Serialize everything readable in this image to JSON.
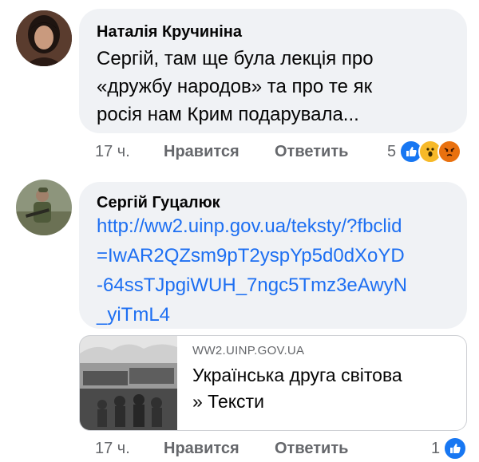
{
  "comments": [
    {
      "author": "Наталія Кручиніна",
      "text_lines": [
        "Сергій, там ще була лекція про",
        "«дружбу народов» та про те як",
        "росія нам Крим подарувала..."
      ],
      "time": "17 ч.",
      "like_label": "Нравится",
      "reply_label": "Ответить",
      "reaction_count": "5",
      "reaction_icons": [
        "like-icon",
        "wow-icon",
        "angry-icon"
      ]
    },
    {
      "author": "Сергій Гуцалюк",
      "link_lines": [
        "http://ww2.uinp.gov.ua/teksty/?fbclid",
        "=IwAR2QZsm9pT2yspYp5d0dXoYD",
        "-64ssTJpgiWUH_7ngc5Tmz3eAwyN",
        "_yiTmL4"
      ],
      "preview": {
        "domain": "WW2.UINP.GOV.UA",
        "title_lines": [
          "Українська друга світова",
          "» Тексти"
        ]
      },
      "time": "17 ч.",
      "like_label": "Нравится",
      "reply_label": "Ответить",
      "reaction_count": "1",
      "reaction_icons": [
        "like-icon"
      ]
    }
  ],
  "colors": {
    "bubble": "#f0f2f5",
    "link": "#1d6ff2",
    "like": "#1877f2",
    "wow": "#f7b928",
    "angry": "#e9710f",
    "muted": "#65676b"
  }
}
